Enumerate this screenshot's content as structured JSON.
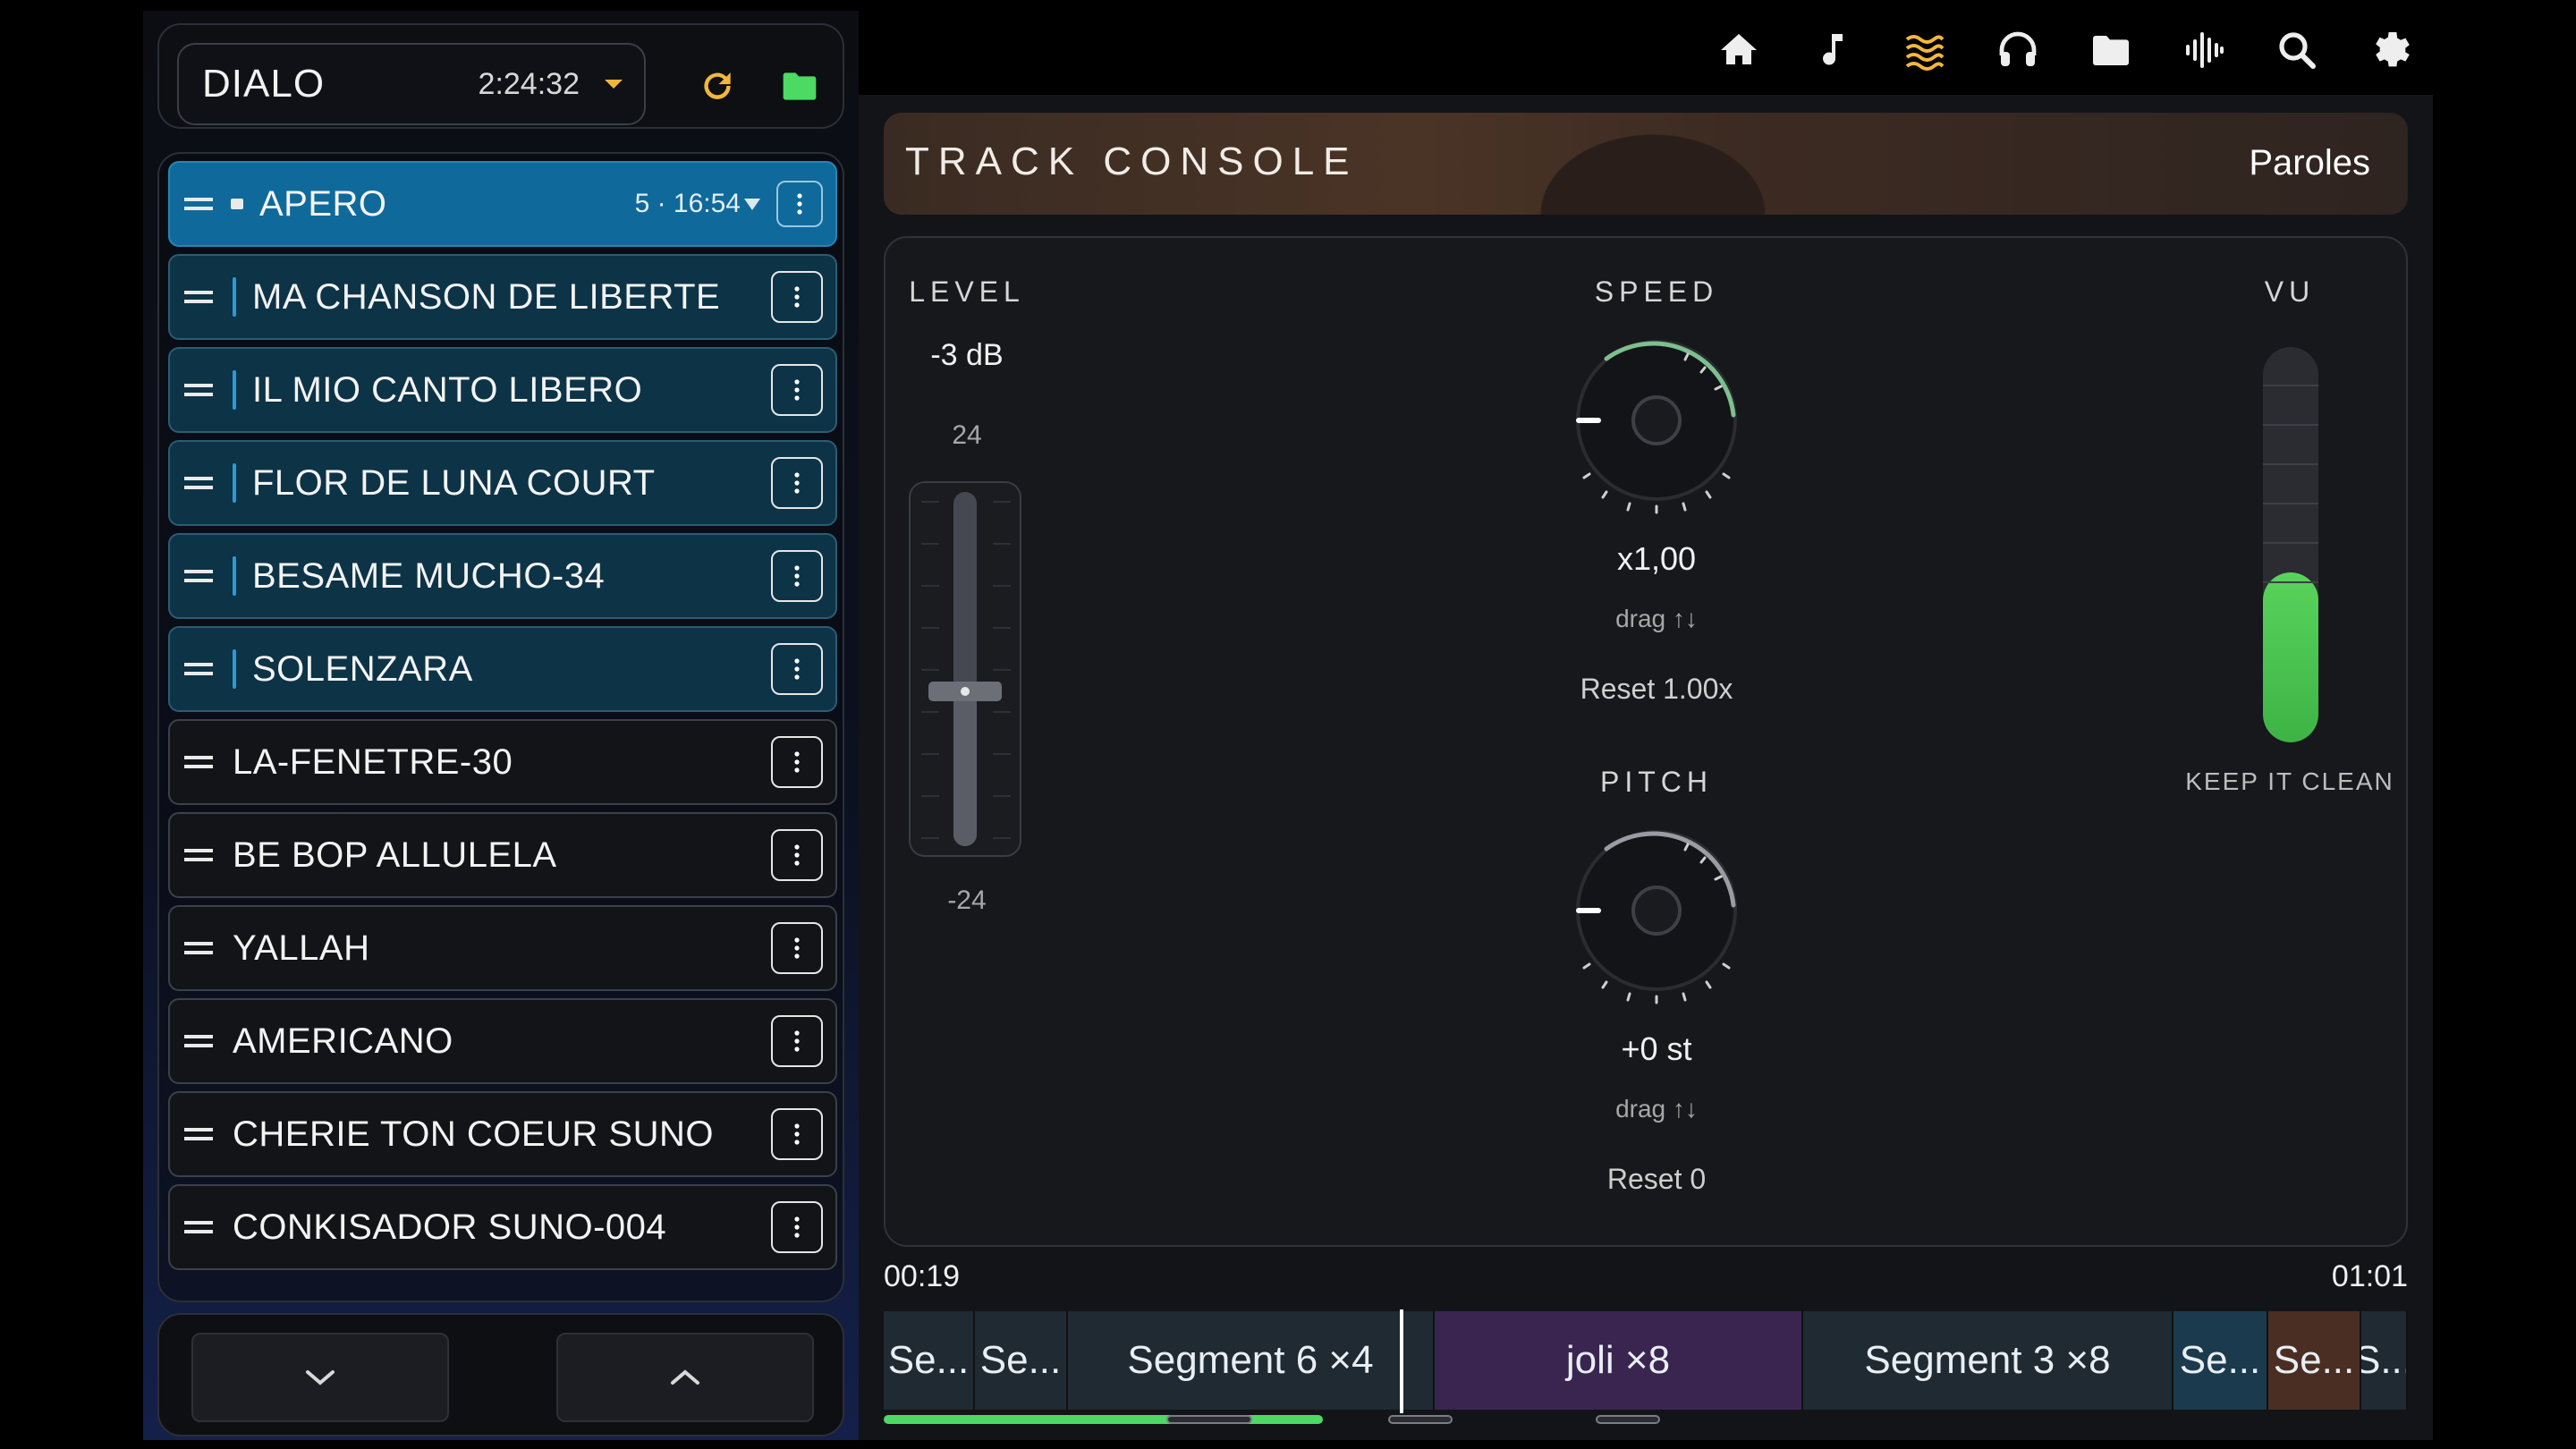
{
  "header": {
    "project_name": "DIALO",
    "project_time": "2:24:32"
  },
  "playlist": {
    "head": {
      "title": "APERO",
      "count": "5 · 16:54"
    },
    "songs": [
      {
        "title": "MA CHANSON DE LIBERTE",
        "in_set": true
      },
      {
        "title": "IL MIO CANTO LIBERO",
        "in_set": true
      },
      {
        "title": "FLOR DE LUNA COURT",
        "in_set": true
      },
      {
        "title": "BESAME MUCHO-34",
        "in_set": true
      },
      {
        "title": "SOLENZARA",
        "in_set": true
      },
      {
        "title": "LA-FENETRE-30",
        "in_set": false
      },
      {
        "title": "BE BOP ALLULELA",
        "in_set": false
      },
      {
        "title": "YALLAH",
        "in_set": false
      },
      {
        "title": "AMERICANO",
        "in_set": false
      },
      {
        "title": "CHERIE TON COEUR SUNO",
        "in_set": false
      },
      {
        "title": "CONKISADOR SUNO-004",
        "in_set": false
      }
    ]
  },
  "topnav": {
    "icons": [
      "home-icon",
      "music-note-icon",
      "waves-icon",
      "headphones-icon",
      "folder-icon",
      "waveform-icon",
      "search-icon",
      "gear-icon"
    ],
    "active": "waves-icon"
  },
  "console": {
    "title": "TRACK CONSOLE",
    "lyrics_button": "Paroles",
    "level": {
      "label": "LEVEL",
      "value": "-3 dB",
      "max_label": "24",
      "min_label": "-24",
      "db": -3,
      "min": -24,
      "max": 24
    },
    "speed": {
      "label": "SPEED",
      "value": "x1,00",
      "hint": "drag ↑↓",
      "reset": "Reset 1.00x"
    },
    "pitch": {
      "label": "PITCH",
      "value": "+0 st",
      "hint": "drag ↑↓",
      "reset": "Reset 0"
    },
    "vu": {
      "label": "VU",
      "status": "KEEP IT CLEAN",
      "level": 0.43
    }
  },
  "timeline": {
    "start": "00:19",
    "end": "01:01",
    "segments": [
      {
        "label": "Se...",
        "color": "#1f2a33"
      },
      {
        "label": "Se...",
        "color": "#1f2a33"
      },
      {
        "label": "Segment 6 ×4",
        "color": "#1f2a33"
      },
      {
        "label": "joli ×8",
        "color": "#3a2550"
      },
      {
        "label": "Segment 3 ×8",
        "color": "#1f2a33"
      },
      {
        "label": "Se...",
        "color": "#1c3a4e"
      },
      {
        "label": "Se...",
        "color": "#4a2e24"
      },
      {
        "label": "S...",
        "color": "#1f2a33"
      }
    ],
    "progress": 0.09
  },
  "colors": {
    "accent_amber": "#f4b63a",
    "accent_green": "#4cd964",
    "accent_blue": "#0f6a9b"
  }
}
